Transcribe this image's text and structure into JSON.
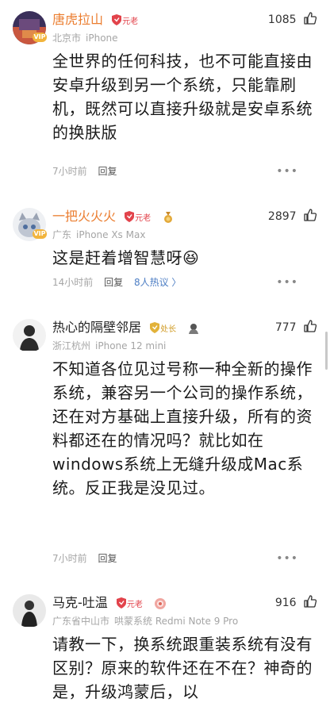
{
  "comments": [
    {
      "username": "唐虎拉山",
      "badge": "元老",
      "likes": "1085",
      "location": "北京市",
      "device": "iPhone",
      "body": "全世界的任何科技，也不可能直接由安卓升级到另一个系统，只能靠刷机，既然可以直接升级就是安卓系统的换肤版",
      "time": "7小时前",
      "reply": "回复"
    },
    {
      "username": "一把火火火",
      "badge": "元老",
      "likes": "2897",
      "location": "广东",
      "device": "iPhone Xs Max",
      "body": "这是赶着增智慧呀😆",
      "time": "14小时前",
      "reply": "回复",
      "hot": "8人热议 〉"
    },
    {
      "username": "热心的隔壁邻居",
      "badge": "处长",
      "likes": "777",
      "location": "浙江杭州",
      "device": "iPhone 12 mini",
      "body": "不知道各位见过号称一种全新的操作系统，兼容另一个公司的操作系统，还在对方基础上直接升级，所有的资料都还在的情况吗？就比如在windows系统上无缝升级成Mac系统。反正我是没见过。",
      "time": "7小时前",
      "reply": "回复"
    },
    {
      "username": "马克-吐温",
      "badge": "元老",
      "likes": "916",
      "location": "广东省中山市",
      "device": "哄蒙系统 Redmi Note 9 Pro",
      "body": "请教一下，换系统跟重装系统有没有区别？原来的软件还在不在？神奇的是，升级鸿蒙后，以"
    }
  ],
  "more_label": "•••",
  "vip_label": "VIP",
  "colors": {
    "name_orange": "#eb7d2f",
    "badge_red": "#e2434b",
    "badge_yellow": "#d09a22",
    "hot_blue": "#4d7ec4"
  }
}
